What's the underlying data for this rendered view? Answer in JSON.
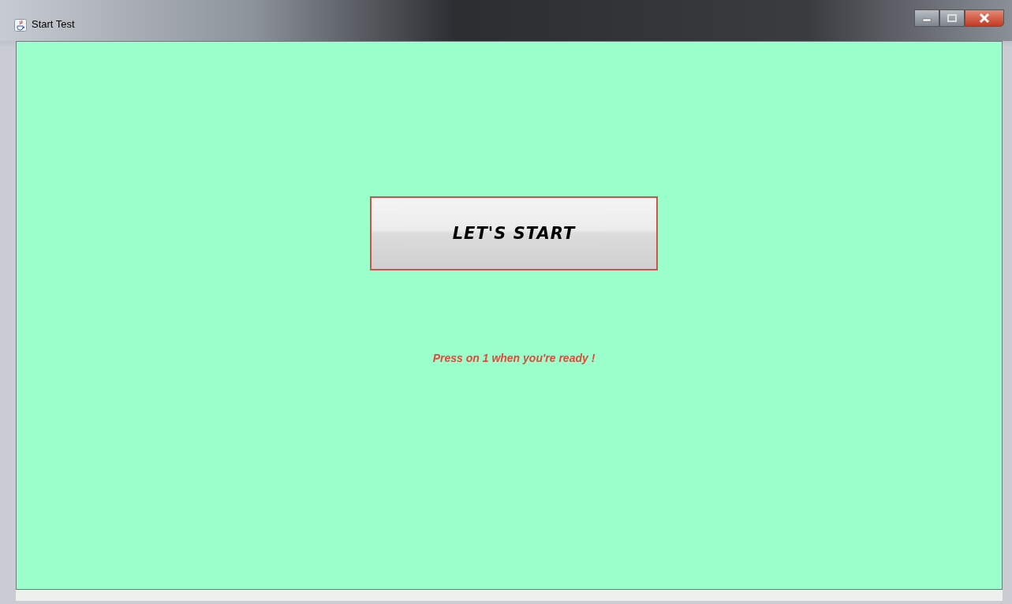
{
  "window": {
    "title": "Start Test"
  },
  "start_button": {
    "label": "LET'S START"
  },
  "instruction": "Press on 1 when you're ready !"
}
